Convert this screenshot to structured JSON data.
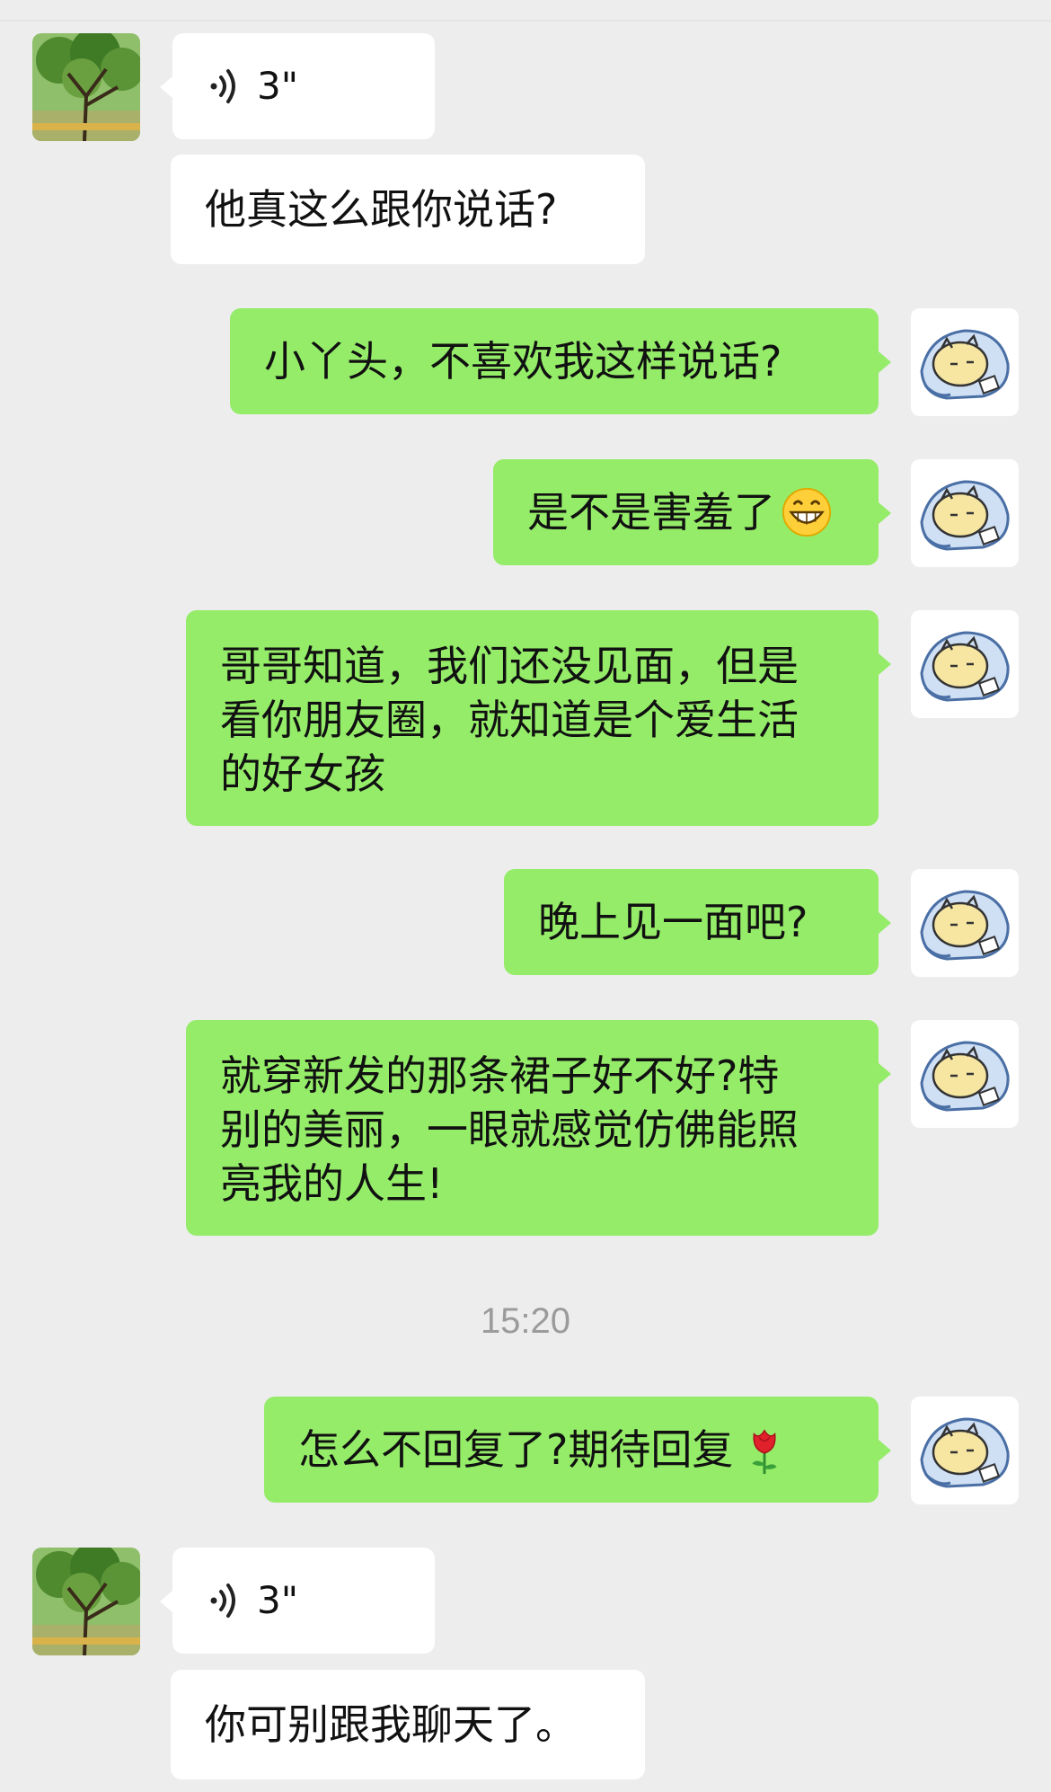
{
  "messages": [
    {
      "side": "left",
      "type": "voice",
      "duration": "3\""
    },
    {
      "side": "left",
      "type": "text",
      "text": "他真这么跟你说话?"
    },
    {
      "side": "right",
      "type": "text",
      "text": "小丫头，不喜欢我这样说话?"
    },
    {
      "side": "right",
      "type": "text",
      "text": "是不是害羞了",
      "emoji": "grinning-face-icon"
    },
    {
      "side": "right",
      "type": "text",
      "lines": [
        "哥哥知道，我们还没见面，但是",
        "看你朋友圈，就知道是个爱生活",
        "的好女孩"
      ]
    },
    {
      "side": "right",
      "type": "text",
      "text": "晚上见一面吧?"
    },
    {
      "side": "right",
      "type": "text",
      "lines": [
        "就穿新发的那条裙子好不好?特",
        "别的美丽，一眼就感觉仿佛能照",
        "亮我的人生!"
      ]
    },
    {
      "side": "right",
      "type": "text",
      "text": "怎么不回复了?期待回复",
      "emoji": "rose-icon"
    },
    {
      "side": "left",
      "type": "voice",
      "duration": "3\""
    },
    {
      "side": "left",
      "type": "text",
      "text": "你可别跟我聊天了。"
    }
  ],
  "timestamp": "15:20",
  "colors": {
    "background": "#ededed",
    "bubble_out": "#95ec69",
    "bubble_in": "#ffffff",
    "timestamp": "#9b9b9b"
  },
  "icons": {
    "contact_avatar": "tree-photo-avatar",
    "self_avatar": "sleeping-cartoon-avatar",
    "voice": "voice-wave-icon"
  }
}
